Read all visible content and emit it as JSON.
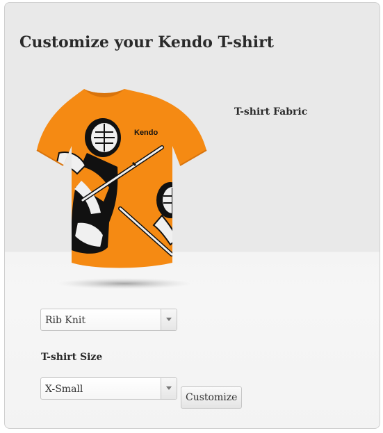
{
  "page": {
    "title": "Customize your Kendo T-shirt"
  },
  "product": {
    "image_alt": "Orange Kendo T-shirt",
    "logo_text": "Kendo",
    "shirt_color": "#f58a13",
    "print_color": "#111111"
  },
  "fabric": {
    "label": "T-shirt Fabric",
    "selected": "Rib Knit"
  },
  "size": {
    "label": "T-shirt Size",
    "selected": "X-Small"
  },
  "actions": {
    "customize_label": "Customize"
  },
  "icons": {
    "dropdown": "chevron-down-icon"
  }
}
